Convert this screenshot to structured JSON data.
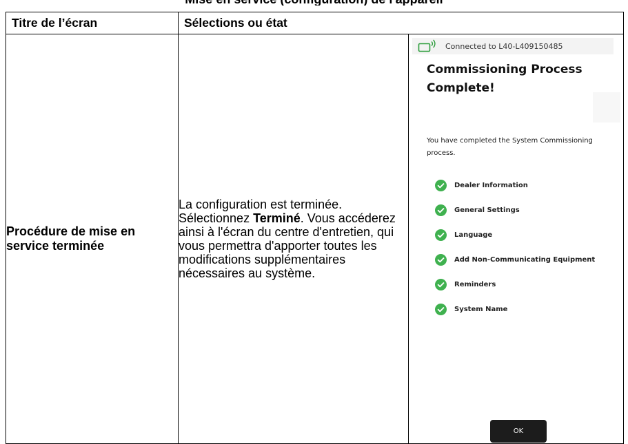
{
  "document": {
    "top_title_fragment": "Mise en service (configuration) de l'appareil"
  },
  "table": {
    "headers": [
      "Titre de l’écran",
      "Sélections ou état"
    ],
    "row": {
      "screen_title": "Procédure de mise en service terminée",
      "desc_before": "La configuration est terminée. Sélectionnez ",
      "desc_bold": "Terminé",
      "desc_after": ". Vous accéderez ainsi à l'écran du centre d'entretien, qui vous permettra d'apporter toutes les modifications supplémentaires nécessaires au système."
    }
  },
  "device_screen": {
    "connection_text": "Connected to L40-L409150485",
    "heading": "Commissioning Process Complete!",
    "intro": "You have completed the System Commissioning process.",
    "completed_items": [
      "Dealer Information",
      "General Settings",
      "Language",
      "Add Non-Communicating Equipment",
      "Reminders",
      "System Name"
    ],
    "ok_label": "OK",
    "colors": {
      "check_green": "#3fb14f",
      "connection_icon_green": "#2e9e3d",
      "button_dark": "#1c1c1c"
    },
    "icons": {
      "connection": "wireless-connection-icon",
      "check": "check-circle-icon"
    }
  }
}
